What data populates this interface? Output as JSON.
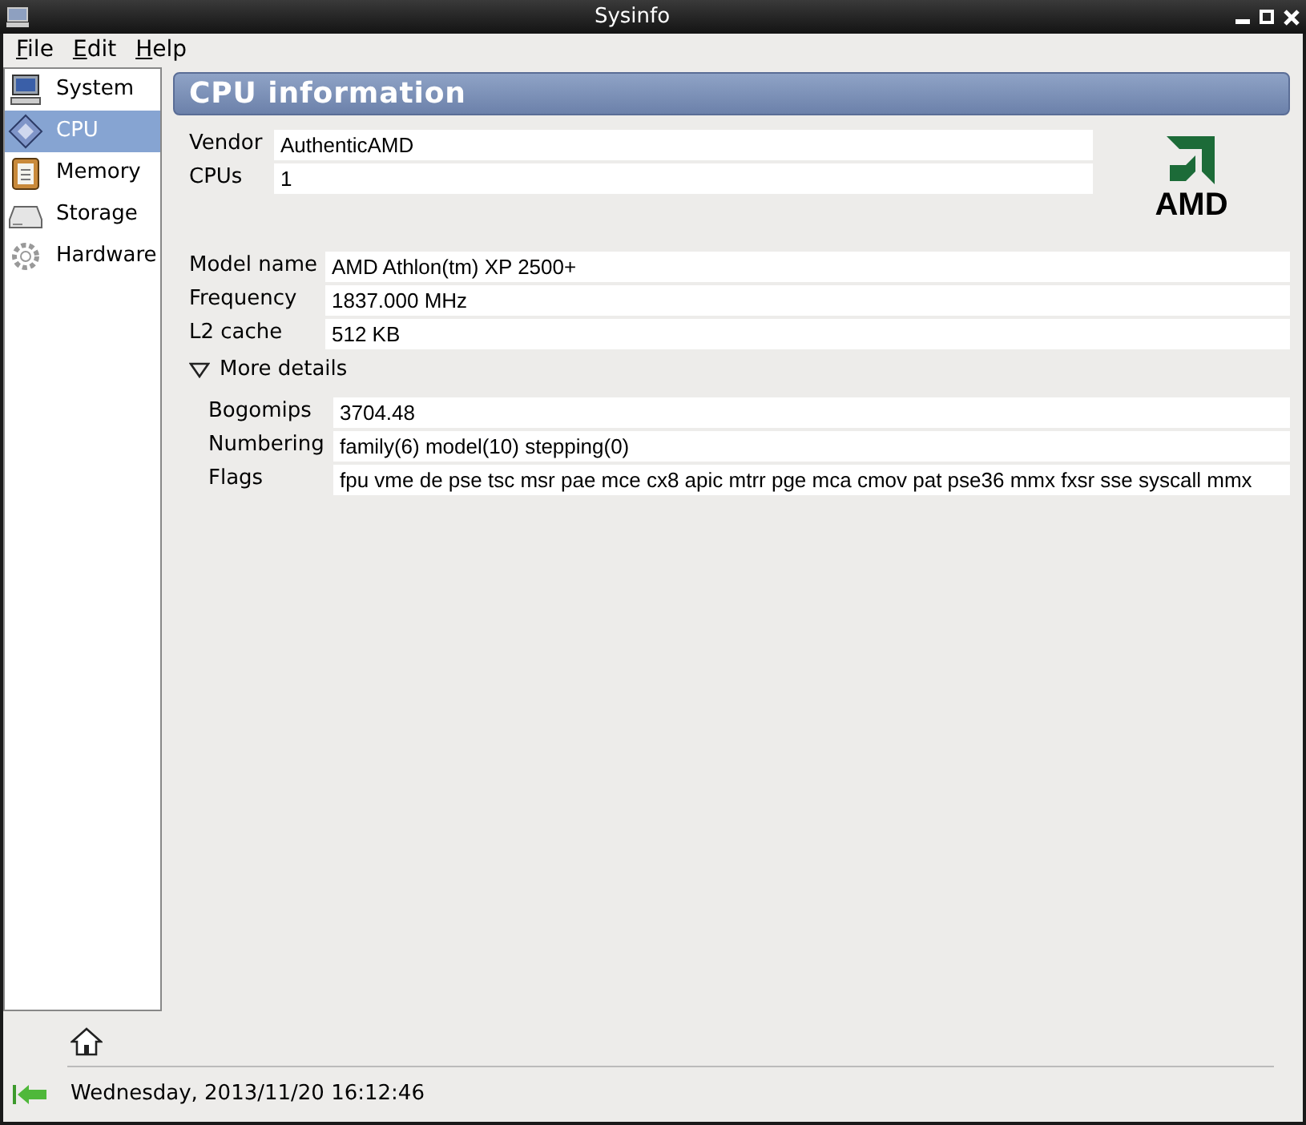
{
  "window": {
    "title": "Sysinfo"
  },
  "menu": [
    "File",
    "Edit",
    "Help"
  ],
  "sidebar": {
    "items": [
      {
        "label": "System",
        "selected": false
      },
      {
        "label": "CPU",
        "selected": true
      },
      {
        "label": "Memory",
        "selected": false
      },
      {
        "label": "Storage",
        "selected": false
      },
      {
        "label": "Hardware",
        "selected": false
      }
    ]
  },
  "header": "CPU information",
  "vendor_fields": [
    {
      "label": "Vendor",
      "value": "AuthenticAMD"
    },
    {
      "label": "CPUs",
      "value": "1"
    }
  ],
  "logo": {
    "text": "AMD"
  },
  "fields": [
    {
      "label": "Model name",
      "value": "AMD Athlon(tm) XP 2500+"
    },
    {
      "label": "Frequency",
      "value": "1837.000 MHz"
    },
    {
      "label": "L2 cache",
      "value": "512 KB"
    }
  ],
  "details": {
    "label": "More details",
    "expanded": true,
    "fields": [
      {
        "label": "Bogomips",
        "value": "3704.48"
      },
      {
        "label": "Numbering",
        "value": "family(6) model(10) stepping(0)"
      },
      {
        "label": "Flags",
        "value": "fpu vme de pse tsc msr pae mce cx8 apic mtrr pge mca cmov pat pse36 mmx fxsr sse syscall mmx"
      }
    ]
  },
  "status_bar": {
    "text": "Wednesday, 2013/11/20 16:12:46"
  }
}
